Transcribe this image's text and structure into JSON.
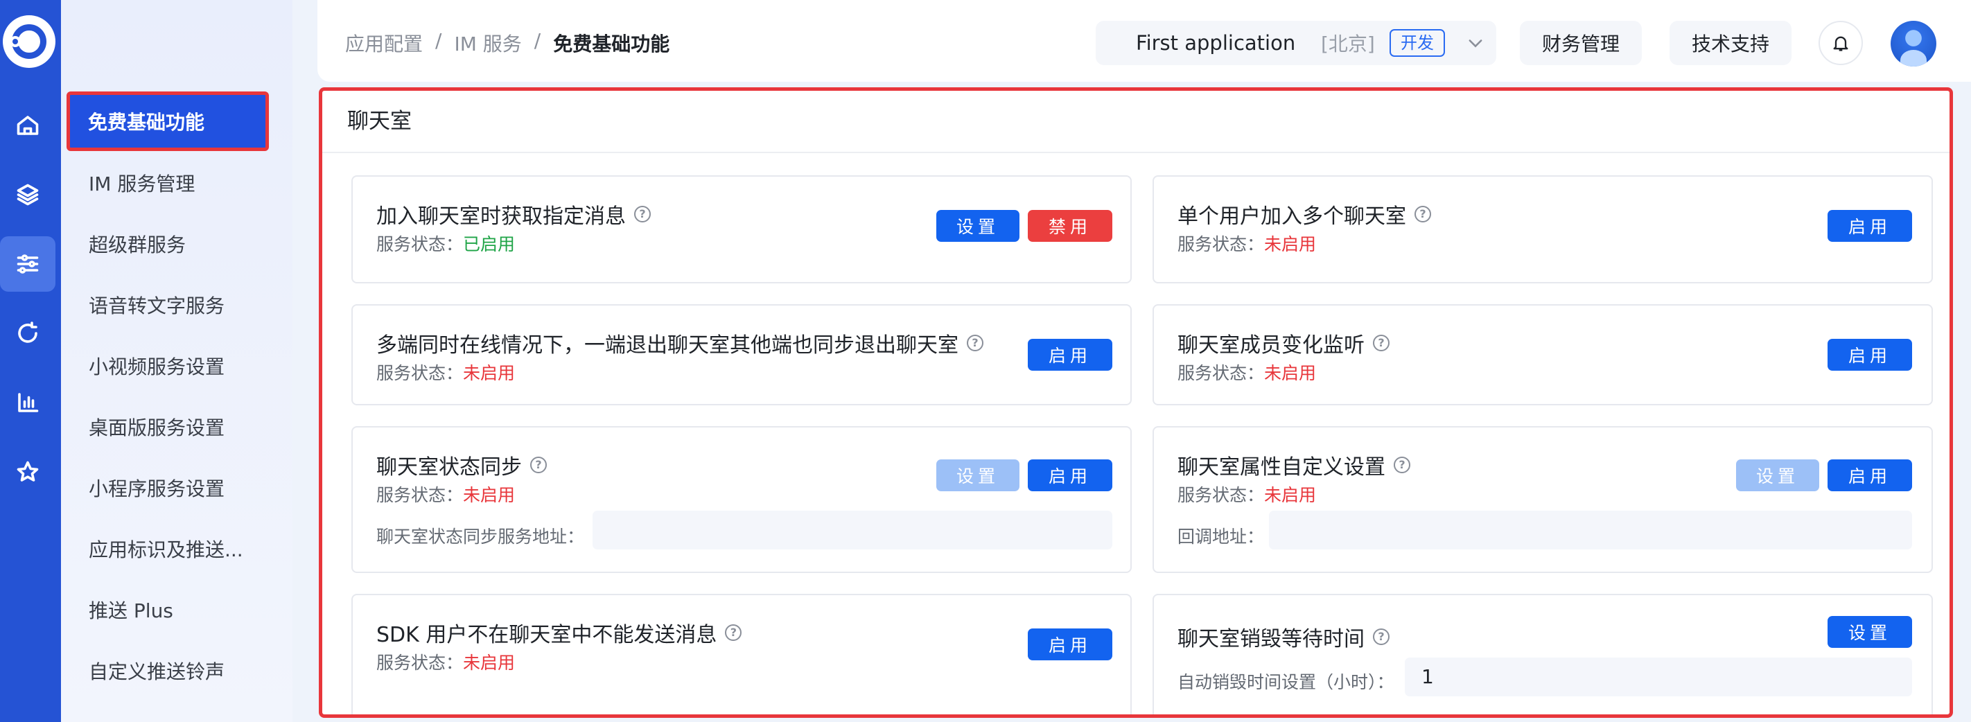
{
  "rail": {
    "icons": [
      "home-icon",
      "layers-icon",
      "sliders-icon",
      "refresh-icon",
      "bar-chart-icon",
      "star-icon"
    ]
  },
  "sidebar": {
    "items": [
      {
        "label": "免费基础功能"
      },
      {
        "label": "IM 服务管理"
      },
      {
        "label": "超级群服务"
      },
      {
        "label": "语音转文字服务"
      },
      {
        "label": "小视频服务设置"
      },
      {
        "label": "桌面版服务设置"
      },
      {
        "label": "小程序服务设置"
      },
      {
        "label": "应用标识及推送..."
      },
      {
        "label": "推送 Plus"
      },
      {
        "label": "自定义推送铃声"
      }
    ]
  },
  "header": {
    "breadcrumb": [
      "应用配置",
      "IM 服务",
      "免费基础功能"
    ],
    "separator": "/",
    "app_name": "First application",
    "app_region": "[北京]",
    "app_env": "开发",
    "finance": "财务管理",
    "support": "技术支持"
  },
  "panel": {
    "title": "聊天室",
    "status_label": "服务状态：",
    "cards": [
      {
        "title": "加入聊天室时获取指定消息",
        "status": "已启用",
        "btn_set": "设置",
        "btn_action": "禁用"
      },
      {
        "title": "单个用户加入多个聊天室",
        "status": "未启用",
        "btn_action": "启用"
      },
      {
        "title": "多端同时在线情况下，一端退出聊天室其他端也同步退出聊天室",
        "status": "未启用",
        "btn_action": "启用"
      },
      {
        "title": "聊天室成员变化监听",
        "status": "未启用",
        "btn_action": "启用"
      },
      {
        "title": "聊天室状态同步",
        "status": "未启用",
        "btn_set": "设置",
        "btn_action": "启用",
        "field_label": "聊天室状态同步服务地址：",
        "field_value": ""
      },
      {
        "title": "聊天室属性自定义设置",
        "status": "未启用",
        "btn_set": "设置",
        "btn_action": "启用",
        "field_label": "回调地址：",
        "field_value": ""
      },
      {
        "title": "SDK 用户不在聊天室中不能发送消息",
        "status": "未启用",
        "btn_action": "启用"
      },
      {
        "title": "聊天室销毁等待时间",
        "btn_set": "设置",
        "field_label": "自动销毁时间设置（小时）：",
        "field_value": "1"
      }
    ]
  },
  "colors": {
    "rail": "#2553d4",
    "primary": "#1363ef",
    "danger": "#eb3f3f",
    "enabled": "#1fa447",
    "disabled_status": "#e8363b",
    "highlight_border": "#e8363b"
  }
}
